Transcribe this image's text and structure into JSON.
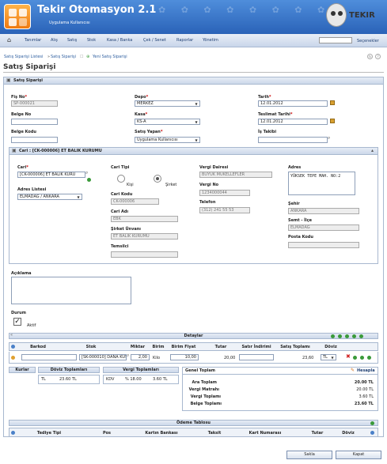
{
  "app": {
    "title": "Tekir Otomasyon 2.1",
    "subtitle": "Uygulama Kullanıcısı",
    "mascot": "TEKIR"
  },
  "menu": [
    "Tanımlar",
    "Alış",
    "Satış",
    "Stok",
    "Kasa / Banka",
    "Çek / Senet",
    "Raporlar",
    "Yönetim"
  ],
  "options_label": "Seçenekler",
  "breadcrumb": {
    "list": "Satış Siparişi Listesi",
    "sep": "»",
    "current": "Satış Siparişi",
    "new": "Yeni Satış Siparişi"
  },
  "page_title": "Satış Siparişi",
  "form_panel_title": "Satış Siparişi",
  "fields": {
    "fis_no": {
      "label": "Fiş No",
      "value": "SP-000021"
    },
    "belge_no": {
      "label": "Belge No",
      "value": ""
    },
    "belge_kodu": {
      "label": "Belge Kodu",
      "value": ""
    },
    "depo": {
      "label": "Depo",
      "value": "MERKEZ"
    },
    "kasa": {
      "label": "Kasa",
      "value": "KS-A"
    },
    "satis_yapan": {
      "label": "Satış Yapan",
      "value": "Uygulama Kullanıcısı"
    },
    "tarih": {
      "label": "Tarih",
      "value": "12.01.2012"
    },
    "teslimat_tarihi": {
      "label": "Teslimat Tarihi",
      "value": "12.01.2012"
    },
    "is_takibi": {
      "label": "İş Takibi",
      "value": ""
    }
  },
  "cari_panel": {
    "title": "Cari : [CK-000006] ET BALIK KURUMU",
    "cari_label": "Cari",
    "cari_value": "[CK-000006] ET BALIK KURU",
    "adres_listesi_label": "Adres Listesi",
    "adres_listesi_value": "ELMADAĞ / ANKARA",
    "cari_tipi_label": "Cari Tipi",
    "kisi_label": "Kişi",
    "sirket_label": "Şirket",
    "cari_kodu_label": "Cari Kodu",
    "cari_kodu_value": "CK-000006",
    "cari_adi_label": "Cari Adı",
    "cari_adi_value": "EBK",
    "sirket_unvani_label": "Şirket Ünvanı",
    "sirket_unvani_value": "ET BALIK KURUMU",
    "temsilci_label": "Temsilci",
    "temsilci_value": "",
    "vergi_dairesi_label": "Vergi Dairesi",
    "vergi_dairesi_value": "BÜYÜK MÜKELLEFLER",
    "vergi_no_label": "Vergi No",
    "vergi_no_value": "1234000044",
    "telefon_label": "Telefon",
    "telefon_value": "(312) 241 55 53",
    "adres_label": "Adres",
    "adres_value": "YÜKSEK TEPE MAH. NO:2",
    "sehir_label": "Şehir",
    "sehir_value": "ANKARA",
    "semt_label": "Semt - İlçe",
    "semt_value": "ELMADAĞ",
    "posta_label": "Posta Kodu",
    "posta_value": ""
  },
  "aciklama_label": "Açıklama",
  "durum_label": "Durum",
  "aktif_label": "Aktif",
  "detaylar": {
    "title": "Detaylar",
    "columns": [
      "Barkod",
      "Stok",
      "Miktar",
      "Birim",
      "Birim Fiyat",
      "Tutar",
      "Satır İndirimi",
      "Satış Toplamı",
      "Döviz"
    ],
    "row": {
      "stok": "[SK-000010] DANA KUŞI",
      "miktar": "2,00",
      "birim": "Kilo",
      "birim_fiyat": "10,00",
      "tutar": "20,00",
      "satis_toplami": "23,60",
      "doviz": "TL"
    }
  },
  "kurlar": {
    "title": "Kurlar"
  },
  "doviz_toplamlari": {
    "title": "Döviz Toplamları",
    "currency": "TL",
    "amount": "23.60 TL"
  },
  "vergi_toplamlari": {
    "title": "Vergi Toplamları",
    "name": "KDV",
    "rate": "% 18.00",
    "amount": "3.60 TL"
  },
  "genel_toplam": {
    "title": "Genel Toplam",
    "hesapla": "Hesapla",
    "rows": [
      {
        "label": "Ara Toplam",
        "value": "20.00 TL"
      },
      {
        "label": "Vergi Matrahı",
        "value": "20.00 TL"
      },
      {
        "label": "Vergi Toplamı",
        "value": "3.60 TL"
      },
      {
        "label": "Belge Toplamı",
        "value": "23.60 TL"
      }
    ]
  },
  "odeme": {
    "title": "Ödeme Tablosu",
    "columns": [
      "Tediye Tipi",
      "Pos",
      "Kartın Bankası",
      "Taksit",
      "Kart Numarası",
      "Tutar",
      "Döviz"
    ]
  },
  "buttons": {
    "save": "Sakla",
    "close": "Kapat"
  }
}
